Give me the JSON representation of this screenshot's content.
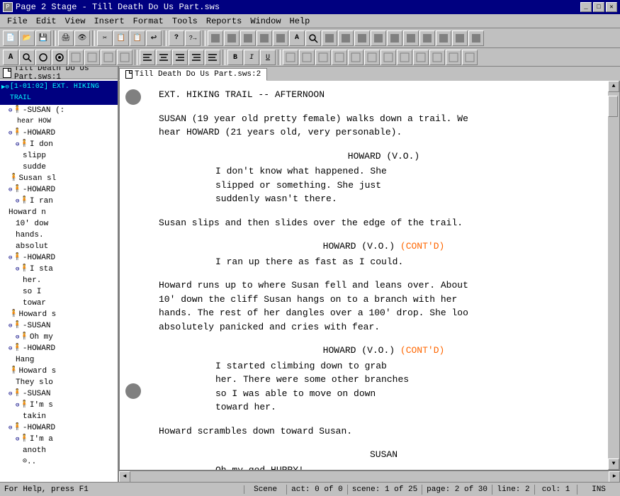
{
  "titleBar": {
    "title": "Page 2 Stage - Till Death Do Us Part.sws",
    "icon": "P",
    "buttons": [
      "_",
      "□",
      "✕"
    ]
  },
  "menuBar": {
    "items": [
      "File",
      "Edit",
      "View",
      "Insert",
      "Format",
      "Tools",
      "Reports",
      "Window",
      "Help"
    ]
  },
  "toolbar1": {
    "buttons": [
      {
        "icon": "📄",
        "name": "new"
      },
      {
        "icon": "📁",
        "name": "open"
      },
      {
        "icon": "💾",
        "name": "save"
      },
      {
        "sep": true
      },
      {
        "icon": "🖨",
        "name": "print"
      },
      {
        "icon": "👁",
        "name": "preview"
      },
      {
        "icon": "✂",
        "name": "cut"
      },
      {
        "sep": true
      },
      {
        "icon": "✂",
        "name": "cut2"
      },
      {
        "icon": "📋",
        "name": "copy"
      },
      {
        "icon": "📌",
        "name": "paste"
      },
      {
        "icon": "↩",
        "name": "undo"
      },
      {
        "sep": true
      },
      {
        "icon": "?",
        "name": "help"
      },
      {
        "icon": "?→",
        "name": "help2"
      },
      {
        "sep": true
      },
      {
        "icon": "⬛",
        "name": "b1"
      },
      {
        "icon": "⬛",
        "name": "b2"
      },
      {
        "icon": "⬛",
        "name": "b3"
      },
      {
        "icon": "⬛",
        "name": "b4"
      },
      {
        "icon": "⬛",
        "name": "b5"
      },
      {
        "icon": "⬛",
        "name": "b6"
      },
      {
        "icon": "A",
        "name": "format-a"
      },
      {
        "icon": "S",
        "name": "format-s"
      },
      {
        "icon": "⬛",
        "name": "b7"
      },
      {
        "icon": "⬛",
        "name": "b8"
      },
      {
        "icon": "⬛",
        "name": "b9"
      },
      {
        "icon": "⬛",
        "name": "b10"
      },
      {
        "icon": "⬛",
        "name": "b11"
      },
      {
        "icon": "⬛",
        "name": "b12"
      },
      {
        "icon": "⬛",
        "name": "b13"
      },
      {
        "icon": "⬛",
        "name": "b14"
      },
      {
        "icon": "⬛",
        "name": "b15"
      }
    ]
  },
  "toolbar2": {
    "buttons": [
      {
        "icon": "A",
        "name": "t1"
      },
      {
        "icon": "🔎",
        "name": "t2"
      },
      {
        "icon": "⊙",
        "name": "t3"
      },
      {
        "icon": "◉",
        "name": "t4"
      },
      {
        "icon": "⬛",
        "name": "t5"
      },
      {
        "icon": "⬛",
        "name": "t6"
      },
      {
        "icon": "⬛",
        "name": "t7"
      },
      {
        "icon": "⬛",
        "name": "t8"
      },
      {
        "sep": true
      },
      {
        "icon": "≡",
        "name": "t9"
      },
      {
        "icon": "≡",
        "name": "t10"
      },
      {
        "icon": "≡",
        "name": "t11"
      },
      {
        "icon": "≡",
        "name": "t12"
      },
      {
        "icon": "≡",
        "name": "t13"
      },
      {
        "icon": "≡",
        "name": "t14"
      },
      {
        "sep": true
      },
      {
        "icon": "B",
        "name": "bold"
      },
      {
        "icon": "I",
        "name": "italic"
      },
      {
        "icon": "U",
        "name": "underline"
      },
      {
        "sep": true
      },
      {
        "icon": "⬛",
        "name": "t15"
      },
      {
        "icon": "⬛",
        "name": "t16"
      },
      {
        "icon": "⬛",
        "name": "t17"
      },
      {
        "icon": "⬛",
        "name": "t18"
      },
      {
        "icon": "⬛",
        "name": "t19"
      },
      {
        "icon": "⬛",
        "name": "t20"
      },
      {
        "icon": "⬛",
        "name": "t21"
      },
      {
        "icon": "⬛",
        "name": "t22"
      },
      {
        "icon": "⬛",
        "name": "t23"
      },
      {
        "icon": "⬛",
        "name": "t24"
      },
      {
        "icon": "⬛",
        "name": "t25"
      },
      {
        "icon": "⬛",
        "name": "t26"
      }
    ]
  },
  "leftPanel": {
    "title": "Till Death Do Us Part.sws:1",
    "treeItems": [
      {
        "level": 0,
        "icon": "▶",
        "type": "scene",
        "text": "[1-01:02]  EXT.  HIKING TRAIL"
      },
      {
        "level": 1,
        "icon": "🧍",
        "type": "character",
        "text": "-SUSAN (:"
      },
      {
        "level": 2,
        "icon": "",
        "type": "action",
        "text": "hear HOW"
      },
      {
        "level": 1,
        "icon": "🧍",
        "type": "character",
        "text": "-HOWARD"
      },
      {
        "level": 2,
        "icon": "🧍",
        "type": "character",
        "text": "I don"
      },
      {
        "level": 2,
        "icon": "",
        "type": "action",
        "text": "slipp"
      },
      {
        "level": 2,
        "icon": "",
        "type": "action",
        "text": "sudde"
      },
      {
        "level": 1,
        "icon": "🧍",
        "type": "character",
        "text": "Susan sl"
      },
      {
        "level": 1,
        "icon": "🧍",
        "type": "character",
        "text": "-HOWARD"
      },
      {
        "level": 2,
        "icon": "🧍",
        "type": "character",
        "text": "I ran"
      },
      {
        "level": 1,
        "icon": "",
        "type": "action",
        "text": "Howard n"
      },
      {
        "level": 2,
        "icon": "",
        "type": "action",
        "text": "10' dow"
      },
      {
        "level": 2,
        "icon": "",
        "type": "action",
        "text": "hands."
      },
      {
        "level": 2,
        "icon": "",
        "type": "action",
        "text": "absolut"
      },
      {
        "level": 1,
        "icon": "🧍",
        "type": "character",
        "text": "-HOWARD"
      },
      {
        "level": 2,
        "icon": "🧍",
        "type": "character",
        "text": "I sta"
      },
      {
        "level": 2,
        "icon": "",
        "type": "action",
        "text": "her."
      },
      {
        "level": 2,
        "icon": "",
        "type": "action",
        "text": "so I"
      },
      {
        "level": 2,
        "icon": "",
        "type": "action",
        "text": "towar"
      },
      {
        "level": 1,
        "icon": "🧍",
        "type": "character",
        "text": "Howard s"
      },
      {
        "level": 1,
        "icon": "🧍",
        "type": "character",
        "text": "-SUSAN"
      },
      {
        "level": 2,
        "icon": "🧍",
        "type": "character",
        "text": "Oh my"
      },
      {
        "level": 1,
        "icon": "🧍",
        "type": "character",
        "text": "-HOWARD"
      },
      {
        "level": 2,
        "icon": "",
        "type": "action",
        "text": "Hang"
      },
      {
        "level": 1,
        "icon": "🧍",
        "type": "character",
        "text": "Howard s"
      },
      {
        "level": 2,
        "icon": "",
        "type": "action",
        "text": "They slo"
      },
      {
        "level": 1,
        "icon": "🧍",
        "type": "character",
        "text": "-SUSAN"
      },
      {
        "level": 2,
        "icon": "🧍",
        "type": "character",
        "text": "I'm s"
      },
      {
        "level": 2,
        "icon": "",
        "type": "action",
        "text": "takin"
      },
      {
        "level": 1,
        "icon": "🧍",
        "type": "character",
        "text": "-HOWARD"
      },
      {
        "level": 2,
        "icon": "🧍",
        "type": "character",
        "text": "I'm a"
      },
      {
        "level": 2,
        "icon": "",
        "type": "action",
        "text": "anoth"
      },
      {
        "level": 2,
        "icon": "⊙",
        "type": "note",
        "text": ".."
      }
    ]
  },
  "scriptPanel": {
    "tab": "Till Death Do Us Part.sws:2",
    "content": [
      {
        "type": "scene-header",
        "text": "EXT.   HIKING TRAIL -- AFTERNOON"
      },
      {
        "type": "action",
        "text": "SUSAN (19 year old pretty female) walks down a trail. We\nhear HOWARD (21 years old, very personable)."
      },
      {
        "type": "character",
        "text": "HOWARD (V.O.)"
      },
      {
        "type": "dialogue",
        "text": "I don't know what happened. She\nslipped or something. She just\nsuddenly wasn't there."
      },
      {
        "type": "action",
        "text": "Susan slips and then slides over the edge of the trail."
      },
      {
        "type": "character-contd",
        "char": "HOWARD (V.O.) ",
        "contd": "(CONT'D)"
      },
      {
        "type": "dialogue",
        "text": "I ran up there as fast as I could."
      },
      {
        "type": "action",
        "text": "Howard runs up to where Susan fell and leans over. About\n10' down the cliff Susan hangs on to a branch with her\nhands. The rest of her dangles over a 100' drop. She loo\nabsolutely panicked and cries with fear."
      },
      {
        "type": "character-contd",
        "char": "HOWARD (V.O.) ",
        "contd": "(CONT'D)"
      },
      {
        "type": "dialogue",
        "text": "I started climbing down to grab\nher. There were some other branches\nso I was able to move on down\ntoward her."
      },
      {
        "type": "action",
        "text": "Howard scrambles down toward Susan."
      },
      {
        "type": "character",
        "text": "SUSAN"
      },
      {
        "type": "dialogue",
        "text": "Oh my god HURRY!"
      }
    ],
    "circleMarker1Top": 178,
    "circleMarker2Top": 590
  },
  "statusBar": {
    "help": "For Help, press F1",
    "scene": "Scene",
    "act": "act: 0 of 0",
    "sceneNum": "scene: 1 of 25",
    "page": "page: 2 of 30",
    "line": "line: 2",
    "col": "col: 1",
    "ins": "INS"
  }
}
